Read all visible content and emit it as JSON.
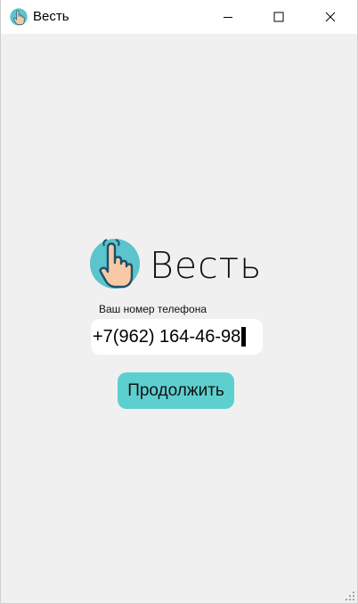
{
  "window": {
    "title": "Весть",
    "controls": {
      "minimize_icon": "minimize-icon",
      "maximize_icon": "maximize-icon",
      "close_icon": "close-icon"
    }
  },
  "login": {
    "logo_icon": "pointing-hand-icon",
    "app_name": "Весть",
    "phone_label": "Ваш номер телефона",
    "phone_value": "+7(962) 164-46-98",
    "continue_label": "Продолжить"
  },
  "colors": {
    "accent": "#5ecfcf",
    "logo_circle": "#5bc4cc",
    "background": "#f0f0f0",
    "titlebar": "#ffffff",
    "input_background": "#ffffff"
  }
}
